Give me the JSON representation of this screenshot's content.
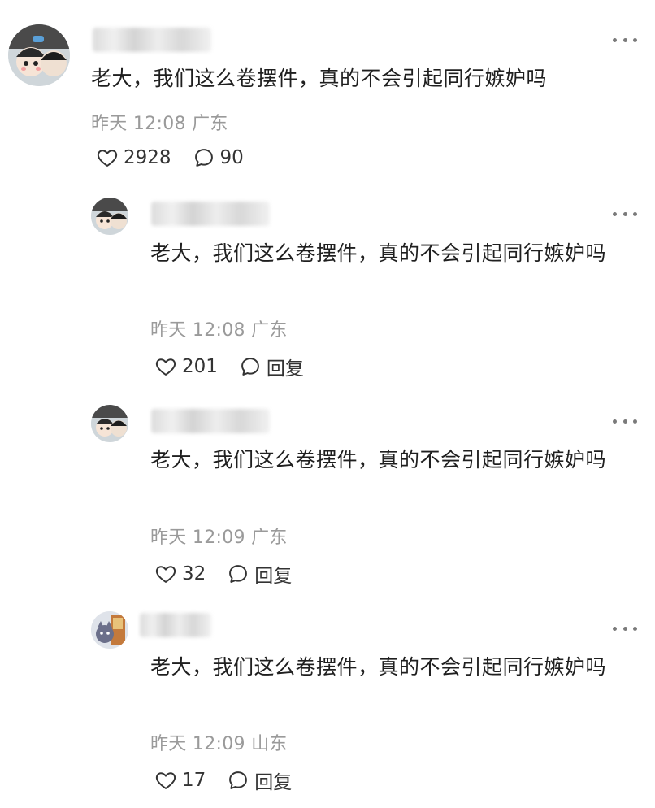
{
  "comments": [
    {
      "text": "老大，我们这么卷摆件，真的不会引起同行嫉妒吗",
      "time": "昨天 12:08 广东",
      "likes": "2928",
      "reply": "90"
    },
    {
      "text": "老大，我们这么卷摆件，真的不会引起同行嫉妒吗",
      "time": "昨天 12:08 广东",
      "likes": "201",
      "reply": "回复"
    },
    {
      "text": "老大，我们这么卷摆件，真的不会引起同行嫉妒吗",
      "time": "昨天 12:09 广东",
      "likes": "32",
      "reply": "回复"
    },
    {
      "text": "老大，我们这么卷摆件，真的不会引起同行嫉妒吗",
      "time": "昨天 12:09 山东",
      "likes": "17",
      "reply": "回复"
    }
  ],
  "icons": {
    "like": "heart-outline-icon",
    "reply": "speech-bubble-icon",
    "more": "ellipsis-icon"
  },
  "colors": {
    "text": "#1f1f1f",
    "meta": "#9a9a9a",
    "icon": "#333333"
  }
}
